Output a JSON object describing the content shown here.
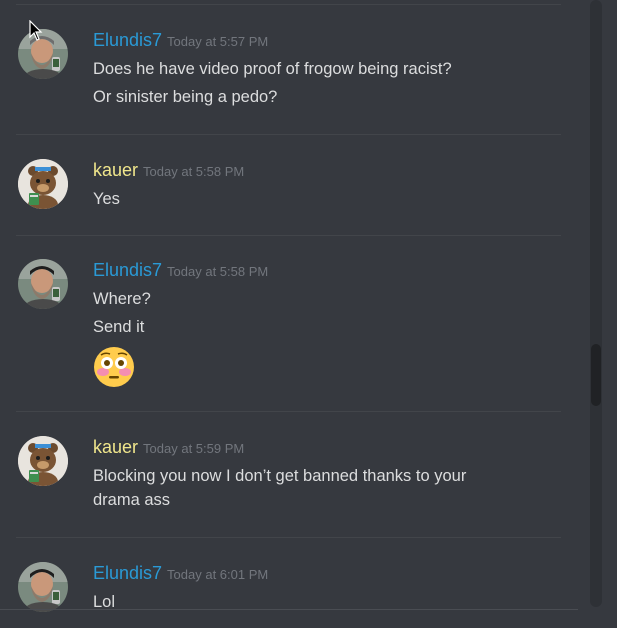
{
  "colors": {
    "background": "#36393f",
    "elundis_name": "#2a9ad6",
    "kauer_name": "#f0e68c",
    "timestamp": "#72767d",
    "message_text": "#dcddde"
  },
  "messages": [
    {
      "author": "Elundis7",
      "timestamp": "Today at 5:57 PM",
      "avatar": "bearded-man-avatar",
      "lines": [
        "Does he have video proof of frogow being racist?",
        "Or sinister being a pedo?"
      ]
    },
    {
      "author": "kauer",
      "timestamp": "Today at 5:58 PM",
      "avatar": "cartoon-bear-avatar",
      "lines": [
        "Yes"
      ]
    },
    {
      "author": "Elundis7",
      "timestamp": "Today at 5:58 PM",
      "avatar": "bearded-man-avatar",
      "lines": [
        "Where?",
        "Send it"
      ],
      "emoji": "flushed-face-emoji"
    },
    {
      "author": "kauer",
      "timestamp": "Today at 5:59 PM",
      "avatar": "cartoon-bear-avatar",
      "lines": [
        "Blocking you now I don’t get banned thanks to your drama ass"
      ]
    },
    {
      "author": "Elundis7",
      "timestamp": "Today at 6:01 PM",
      "avatar": "bearded-man-avatar",
      "lines": [
        "Lol"
      ]
    }
  ]
}
